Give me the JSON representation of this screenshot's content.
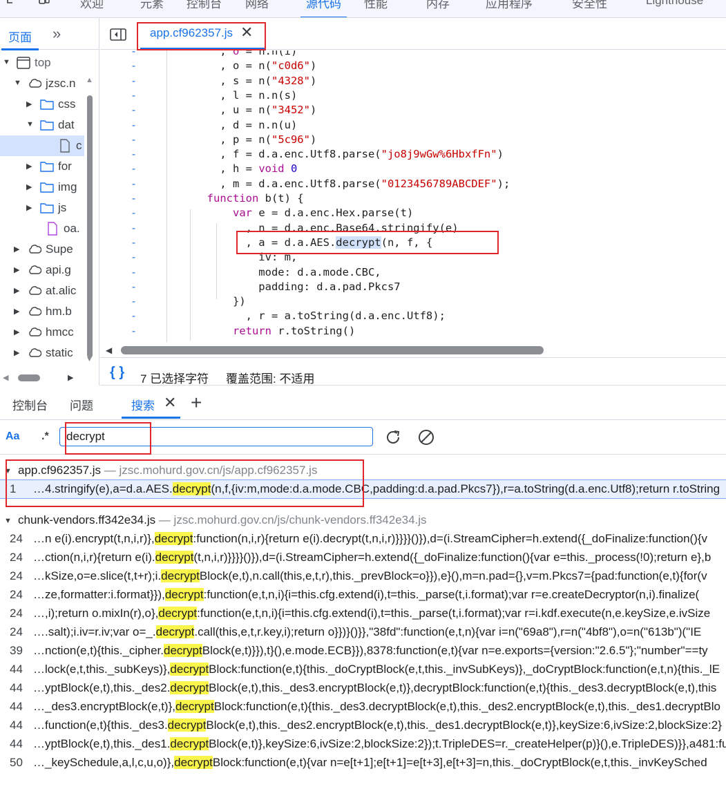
{
  "top_tabs": [
    "欢迎",
    "元素",
    "控制台",
    "网络",
    "源代码",
    "性能",
    "内存",
    "应用程序",
    "安全性",
    "Lighthouse"
  ],
  "top_tabs_active": "源代码",
  "navigator": {
    "tab_label": "页面",
    "more_label": "»",
    "tree": [
      {
        "label": "top",
        "icon": "frame-icon",
        "arrow": "down"
      },
      {
        "label": "jzsc.n",
        "icon": "cloud-icon",
        "arrow": "down"
      },
      {
        "label": "css",
        "icon": "folder-icon",
        "arrow": "right"
      },
      {
        "label": "dat",
        "icon": "folder-icon",
        "arrow": "down"
      },
      {
        "label": "c",
        "icon": "file-icon",
        "arrow": ""
      },
      {
        "label": "for",
        "icon": "folder-icon",
        "arrow": "right"
      },
      {
        "label": "img",
        "icon": "folder-icon",
        "arrow": "right"
      },
      {
        "label": "js",
        "icon": "folder-icon",
        "arrow": "right"
      },
      {
        "label": "oa.",
        "icon": "file-icon",
        "arrow": ""
      },
      {
        "label": "Supe",
        "icon": "cloud-icon",
        "arrow": "right"
      },
      {
        "label": "api.g",
        "icon": "cloud-icon",
        "arrow": "right"
      },
      {
        "label": "at.alic",
        "icon": "cloud-icon",
        "arrow": "right"
      },
      {
        "label": "hm.b",
        "icon": "cloud-icon",
        "arrow": "right"
      },
      {
        "label": "hmcc",
        "icon": "cloud-icon",
        "arrow": "right"
      },
      {
        "label": "static",
        "icon": "cloud-icon",
        "arrow": "right"
      }
    ]
  },
  "editor": {
    "file_tab": "app.cf962357.js",
    "code_lines": [
      {
        "html": "          , <span class=\"kw\">o</span> = n.n(i)"
      },
      {
        "html": "          , o = n(<span class=\"str\">\"c0d6\"</span>)"
      },
      {
        "html": "          , s = n(<span class=\"str\">\"4328\"</span>)"
      },
      {
        "html": "          , l = n.n(s)"
      },
      {
        "html": "          , u = n(<span class=\"str\">\"3452\"</span>)"
      },
      {
        "html": "          , d = n.n(u)"
      },
      {
        "html": "          , p = n(<span class=\"str\">\"5c96\"</span>)"
      },
      {
        "html": "          , f = d.a.enc.Utf8.parse(<span class=\"str\">\"jo8j9wGw%6HbxfFn\"</span>)"
      },
      {
        "html": "          , h = <span class=\"kw\">void</span> <span class=\"num\">0</span>"
      },
      {
        "html": "          , m = d.a.enc.Utf8.parse(<span class=\"str\">\"0123456789ABCDEF\"</span>);"
      },
      {
        "html": "        <span class=\"kw\">function</span> b(t) {"
      },
      {
        "html": "            <span class=\"kw\">var</span> e = d.a.enc.Hex.parse(t)"
      },
      {
        "html": "              , n = d.a.enc.Base64.stringify(e)"
      },
      {
        "html": "              , a = d.a.AES.<span class=\"hl-word\">decrypt</span>(n, f, {"
      },
      {
        "html": "                iv: m,"
      },
      {
        "html": "                mode: d.a.mode.CBC,"
      },
      {
        "html": "                padding: d.a.pad.Pkcs7"
      },
      {
        "html": "            })"
      },
      {
        "html": "              , r = a.toString(d.a.enc.Utf8);"
      },
      {
        "html": "            <span class=\"kw\">return</span> r.toString()"
      }
    ],
    "selected_chars": "7 已选择字符",
    "coverage": "覆盖范围: 不适用",
    "braces": "{ }"
  },
  "drawer": {
    "tabs": [
      "控制台",
      "问题",
      "搜索"
    ],
    "active_tab": "搜索",
    "add_label": "+",
    "search": {
      "case_label": "Aa",
      "regex_label": ".*",
      "query": "decrypt"
    }
  },
  "results": {
    "files": [
      {
        "name": "app.cf962357.js",
        "path": " — jzsc.mohurd.gov.cn/js/app.cf962357.js",
        "matches": [
          {
            "line": "1",
            "pre": "…4.stringify(e),a=d.a.AES.",
            "hit": "decrypt",
            "post": "(n,f,{iv:m,mode:d.a.mode.CBC,padding:d.a.pad.Pkcs7}),r=a.toString(d.a.enc.Utf8);return r.toString"
          }
        ]
      },
      {
        "name": "chunk-vendors.ff342e34.js",
        "path": " — jzsc.mohurd.gov.cn/js/chunk-vendors.ff342e34.js",
        "matches": [
          {
            "line": "24",
            "pre": "…n e(i).encrypt(t,n,i,r)},",
            "hit": "decrypt",
            "post": ":function(n,i,r){return e(i).decrypt(t,n,i,r)}}}}()}),d=(i.StreamCipher=h.extend({_doFinalize:function(){v"
          },
          {
            "line": "24",
            "pre": "…ction(n,i,r){return e(i).",
            "hit": "decrypt",
            "post": "(t,n,i,r)}}}}()}),d=(i.StreamCipher=h.extend({_doFinalize:function(){var e=this._process(!0);return e},b"
          },
          {
            "line": "24",
            "pre": "…kSize,o=e.slice(t,t+r);i.",
            "hit": "decrypt",
            "post": "Block(e,t),n.call(this,e,t,r),this._prevBlock=o}}),e}(),m=n.pad={},v=m.Pkcs7={pad:function(e,t){for(v"
          },
          {
            "line": "24",
            "pre": "…ze,formatter:i.format}}),",
            "hit": "decrypt",
            "post": ":function(e,t,n,i){i=this.cfg.extend(i),t=this._parse(t,i.format);var r=e.createDecryptor(n,i).finalize("
          },
          {
            "line": "24",
            "pre": "…,i);return o.mixIn(r),o},",
            "hit": "decrypt",
            "post": ":function(e,t,n,i){i=this.cfg.extend(i),t=this._parse(t,i.format);var r=i.kdf.execute(n,e.keySize,e.ivSize"
          },
          {
            "line": "24",
            "pre": "….salt);i.iv=r.iv;var o=_.",
            "hit": "decrypt",
            "post": ".call(this,e,t,r.key,i);return o}})}()}},\"38fd\":function(e,t,n){var i=n(\"69a8\"),r=n(\"4bf8\"),o=n(\"613b\")(\"IE"
          },
          {
            "line": "39",
            "pre": "…nction(e,t){this._cipher.",
            "hit": "decrypt",
            "post": "Block(e,t)}}),t}(),e.mode.ECB}}),8378:function(e,t){var n=e.exports={version:\"2.6.5\"};\"number\"==ty"
          },
          {
            "line": "44",
            "pre": "…lock(e,t,this._subKeys)},",
            "hit": "decrypt",
            "post": "Block:function(e,t){this._doCryptBlock(e,t,this._invSubKeys)},_doCryptBlock:function(e,t,n){this._lE"
          },
          {
            "line": "44",
            "pre": "…yptBlock(e,t),this._des2.",
            "hit": "decrypt",
            "post": "Block(e,t),this._des3.encryptBlock(e,t)},decryptBlock:function(e,t){this._des3.decryptBlock(e,t),this"
          },
          {
            "line": "44",
            "pre": "…_des3.encryptBlock(e,t)},",
            "hit": "decrypt",
            "post": "Block:function(e,t){this._des3.decryptBlock(e,t),this._des2.encryptBlock(e,t),this._des1.decryptBlo"
          },
          {
            "line": "44",
            "pre": "…function(e,t){this._des3.",
            "hit": "decrypt",
            "post": "Block(e,t),this._des2.encryptBlock(e,t),this._des1.decryptBlock(e,t)},keySize:6,ivSize:2,blockSize:2}"
          },
          {
            "line": "44",
            "pre": "…yptBlock(e,t),this._des1.",
            "hit": "decrypt",
            "post": "Block(e,t)},keySize:6,ivSize:2,blockSize:2});t.TripleDES=r._createHelper(p)}(),e.TripleDES)}},a481:fu"
          },
          {
            "line": "50",
            "pre": "…_keySchedule,a,l,c,u,o)},",
            "hit": "decrypt",
            "post": "Block:function(e,t){var n=e[t+1];e[t+1]=e[t+3],e[t+3]=n,this._doCryptBlock(e,t,this._invKeySched"
          }
        ]
      }
    ]
  },
  "colors": {
    "accent": "#1a73e8",
    "highlight": "#f9f54a",
    "annotation": "#e1262b"
  }
}
